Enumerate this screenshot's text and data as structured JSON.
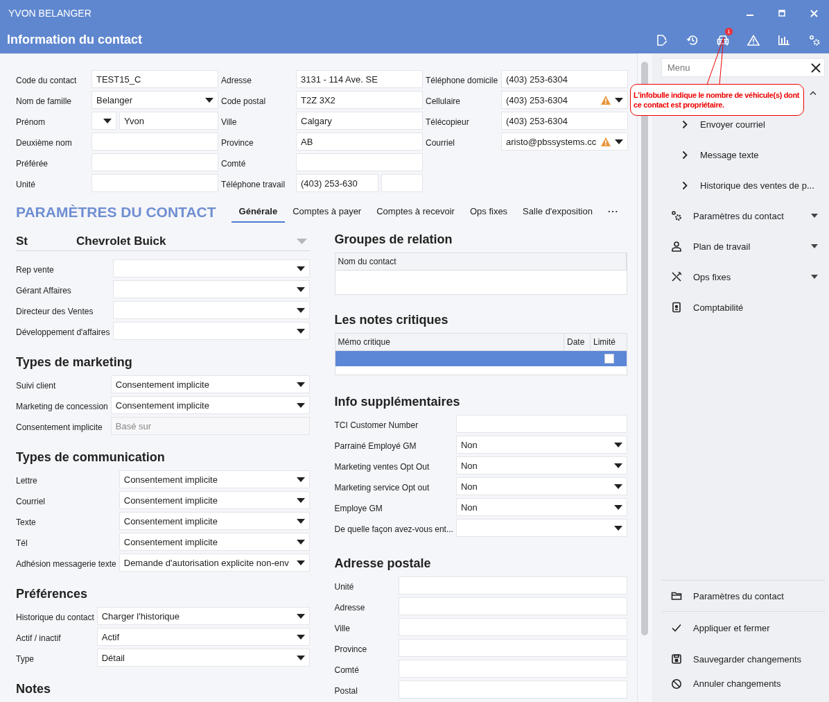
{
  "window": {
    "title": "YVON BELANGER"
  },
  "header": {
    "title": "Information du contact",
    "vehicle_badge": "1"
  },
  "tooltip": {
    "text": "L'infobulle indique le nombre de véhicule(s) dont ce contact est propriétaire."
  },
  "contact_form": [
    [
      {
        "label": "Code du contact",
        "kind": "text",
        "value": "TEST15_C",
        "warning": false
      },
      {
        "label": "Nom de famille",
        "kind": "select",
        "value": "Belanger",
        "warning": false
      },
      {
        "label": "Prénom",
        "kind": "title_select",
        "value": "Yvon",
        "warning": false
      },
      {
        "label": "Deuxième nom",
        "kind": "text",
        "warning": false
      },
      {
        "label": "Préférée",
        "kind": "text",
        "warning": false
      },
      {
        "label": "Unité",
        "kind": "text",
        "warning": false
      }
    ],
    [
      {
        "label": "Adresse",
        "kind": "text",
        "value": "3131 - 114 Ave. SE",
        "warning": false
      },
      {
        "label": "Code postal",
        "kind": "text",
        "value": "T2Z 3X2",
        "warning": false
      },
      {
        "label": "Ville",
        "kind": "text",
        "value": "Calgary",
        "warning": false
      },
      {
        "label": "Province",
        "kind": "text",
        "value": "AB",
        "warning": false
      },
      {
        "label": "Comté",
        "kind": "text",
        "warning": false
      },
      {
        "label": "Téléphone travail",
        "kind": "two_part",
        "value": "(403) 253-630",
        "warning": false
      }
    ],
    [
      {
        "label": "Téléphone domicile",
        "kind": "text",
        "value": "(403) 253-6304",
        "warning": false
      },
      {
        "label": "Cellulaire",
        "kind": "select",
        "value": "(403) 253-6304",
        "warning": true
      },
      {
        "label": "Télécopieur",
        "kind": "text",
        "value": "(403) 253-6304",
        "warning": false
      },
      {
        "label": "Courriel",
        "kind": "select",
        "value": "aristo@pbssystems.cc",
        "warning": true
      }
    ]
  ],
  "settings": {
    "title": "PARAMÈTRES DU CONTACT",
    "more": "···",
    "tabs": [
      {
        "label": "Générale",
        "selected": true
      },
      {
        "label": "Comptes à payer",
        "selected": false
      },
      {
        "label": "Comptes à recevoir",
        "selected": false
      },
      {
        "label": "Ops fixes",
        "selected": false
      },
      {
        "label": "Salle d'exposition",
        "selected": false
      }
    ]
  },
  "dealer": {
    "code": "St",
    "name": "Chevrolet Buick",
    "rows": [
      {
        "label": "Rep vente",
        "kind": "select"
      },
      {
        "label": "Gérant Affaires",
        "kind": "select"
      },
      {
        "label": "Directeur des Ventes",
        "kind": "select"
      },
      {
        "label": "Développement d'affaires",
        "kind": "select"
      }
    ]
  },
  "left_sections": [
    {
      "title": "Types de marketing",
      "rows": [
        {
          "label": "Suivi client",
          "kind": "select",
          "value": "Consentement implicite"
        },
        {
          "label": "Marketing de concession",
          "kind": "select",
          "value": "Consentement implicite"
        },
        {
          "label": "Consentement implicite",
          "kind": "text",
          "placeholder": "Basé sur"
        }
      ]
    },
    {
      "title": "Types de communication",
      "rows": [
        {
          "label": "Lettre",
          "kind": "select",
          "value": "Consentement implicite"
        },
        {
          "label": "Courriel",
          "kind": "select",
          "value": "Consentement implicite"
        },
        {
          "label": "Texte",
          "kind": "select",
          "value": "Consentement implicite"
        },
        {
          "label": "Tél",
          "kind": "select",
          "value": "Consentement implicite"
        },
        {
          "label": "Adhésion messagerie texte",
          "kind": "select",
          "value": "Demande d'autorisation explicite non-env"
        }
      ]
    },
    {
      "title": "Préférences",
      "rows": [
        {
          "label": "Historique du contact",
          "kind": "select",
          "value": "Charger l'historique"
        },
        {
          "label": "Actif / inactif",
          "kind": "select",
          "value": "Actif"
        },
        {
          "label": "Type",
          "kind": "select",
          "value": "Détail"
        }
      ]
    },
    {
      "title": "Notes"
    }
  ],
  "right_sections": [
    {
      "title": "Groupes de relation",
      "kind": "table",
      "columns": [
        "Nom du contact"
      ]
    },
    {
      "title": "Les notes critiques",
      "kind": "table",
      "columns": [
        "Mémo critique",
        "Date",
        "Limité"
      ],
      "rows": [
        {
          "selected": true,
          "limited": false
        }
      ]
    },
    {
      "title": "Info supplémentaires",
      "kind": "form",
      "rows": [
        {
          "label": "TCI Customer Number",
          "kind": "text"
        },
        {
          "label": "Parrainé Employé GM",
          "kind": "select",
          "value": "Non"
        },
        {
          "label": "Marketing ventes Opt Out",
          "kind": "select",
          "value": "Non"
        },
        {
          "label": "Marketing service Opt out",
          "kind": "select",
          "value": "Non"
        },
        {
          "label": "Employe GM",
          "kind": "select",
          "value": "Non"
        },
        {
          "label": "De quelle façon avez-vous ent...",
          "kind": "select"
        }
      ]
    },
    {
      "title": "Adresse postale",
      "kind": "form",
      "rows": [
        {
          "label": "Unité",
          "kind": "text"
        },
        {
          "label": "Adresse",
          "kind": "text"
        },
        {
          "label": "Ville",
          "kind": "text"
        },
        {
          "label": "Province",
          "kind": "text"
        },
        {
          "label": "Comté",
          "kind": "text"
        },
        {
          "label": "Postal",
          "kind": "text"
        }
      ]
    }
  ],
  "sidebar": {
    "search_placeholder": "Menu",
    "group_expanded": true,
    "sub_items": [
      "Envoyer courriel",
      "Message texte",
      "Historique des ventes de p..."
    ],
    "items": [
      {
        "label": "Paramètres du contact",
        "kind": "gears",
        "expanded": false
      },
      {
        "label": "Plan de travail",
        "kind": "person",
        "expanded": false
      },
      {
        "label": "Ops fixes",
        "kind": "tools",
        "expanded": false
      },
      {
        "label": "Comptabilité",
        "kind": "ledger"
      }
    ],
    "actions": [
      {
        "label": "Paramètres du contact",
        "kind": "folder"
      },
      {
        "label": "Appliquer et fermer",
        "kind": "check"
      },
      {
        "label": "Sauvegarder changements",
        "kind": "save"
      },
      {
        "label": "Annuler changements",
        "kind": "cancel"
      }
    ]
  }
}
